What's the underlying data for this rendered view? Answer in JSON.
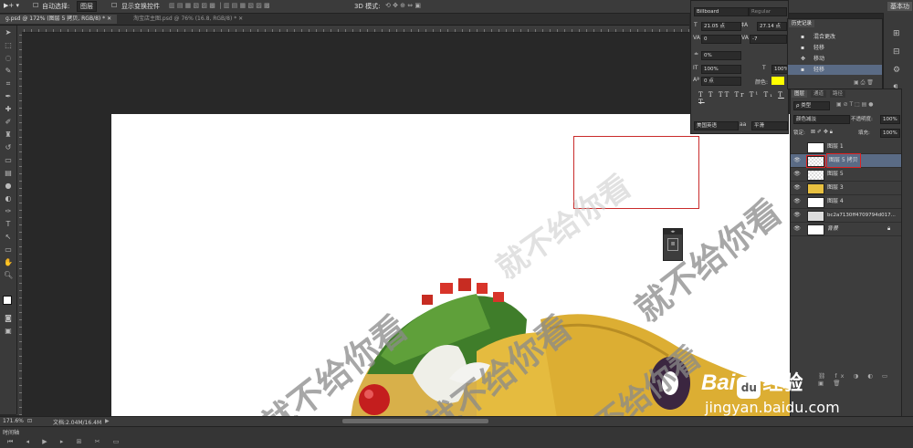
{
  "menubar": {
    "auto_select_label": "自动选择:",
    "auto_select_value": "图层",
    "show_transform_label": "显示变换控件",
    "mode_3d_label": "3D 模式:",
    "workspace_label": "基本功"
  },
  "tabs": [
    {
      "label": "ɡ.psd @ 172% (图层 5 拷贝, RGB/8) *"
    },
    {
      "label": "淘宝店主图.psd @ 76% (16.8, RGB/8) *"
    }
  ],
  "watermark_text": "就不给你看",
  "character_panel": {
    "font_family": "Billboard",
    "font_style": "Regular",
    "font_size": "21.05 点",
    "leading": "27.14 点",
    "kerning": "0",
    "tracking": "-7",
    "tsume": "0%",
    "vertical_scale": "100%",
    "horizontal_scale": "100%",
    "baseline_shift": "0 点",
    "color_label": "颜色:",
    "color_swatch": "#ffff00",
    "style_buttons": [
      "T",
      "T",
      "TT",
      "Tr",
      "T¹",
      "T₁",
      "T",
      "T"
    ],
    "language": "美国英语",
    "antialias": "平滑",
    "aa_icon": "aa"
  },
  "history_panel": {
    "title": "历史记录",
    "items": [
      "混合更改",
      "轻移",
      "移动",
      "轻移"
    ]
  },
  "layers_panel": {
    "tabs": [
      "图层",
      "通道",
      "路径"
    ],
    "filter_label": "ρ 类型",
    "blend_mode": "颜色减淡",
    "opacity_label": "不透明度:",
    "opacity_value": "100%",
    "lock_label": "锁定:",
    "fill_label": "填充:",
    "fill_value": "100%",
    "layers": [
      {
        "name": "图层 1",
        "visible": false,
        "selected": false
      },
      {
        "name": "图层 5 拷贝",
        "visible": true,
        "selected": true
      },
      {
        "name": "图层 5",
        "visible": true,
        "selected": false
      },
      {
        "name": "图层 3",
        "visible": true,
        "selected": false
      },
      {
        "name": "图层 4",
        "visible": true,
        "selected": false
      },
      {
        "name": "bc2a7130ff4709794d017...",
        "visible": true,
        "selected": false
      },
      {
        "name": "背景",
        "visible": true,
        "selected": false
      }
    ]
  },
  "statusbar": {
    "zoom": "171.6%",
    "doc_info": "文档:2.04M/16.4M",
    "timeline_label": "时间轴"
  },
  "baidu": {
    "brand_left": "Bai",
    "brand_paw": "du",
    "brand_right": "经验",
    "url": "jingyan.baidu.com"
  }
}
